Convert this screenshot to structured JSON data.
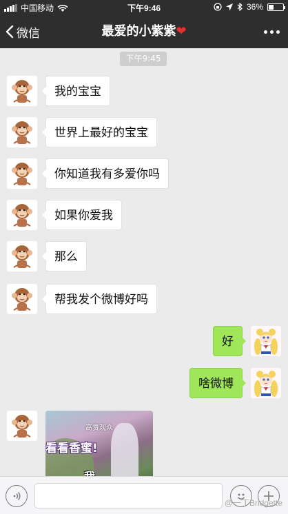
{
  "status_bar": {
    "carrier": "中国移动",
    "time": "下午9:46",
    "battery": "36%",
    "battery_level": 0.36
  },
  "nav": {
    "back_label": "微信",
    "title": "最爱的小紫紫",
    "title_emoji": "❤"
  },
  "chat": {
    "timestamp": "下午9:45",
    "messages": [
      {
        "side": "in",
        "text": "我的宝宝"
      },
      {
        "side": "in",
        "text": "世界上最好的宝宝"
      },
      {
        "side": "in",
        "text": "你知道我有多爱你吗"
      },
      {
        "side": "in",
        "text": "如果你爱我"
      },
      {
        "side": "in",
        "text": "那么"
      },
      {
        "side": "in",
        "text": "帮我发个微博好吗"
      },
      {
        "side": "out",
        "text": "好"
      },
      {
        "side": "out",
        "text": "啥微博"
      }
    ],
    "media_message": {
      "caption_top": "高贵观众",
      "caption_middle": "看看香蜜!",
      "caption_bottom": "我"
    }
  },
  "input_bar": {
    "placeholder": "",
    "voice_icon": "voice-icon",
    "emoji_icon": "emoji-icon",
    "plus_icon": "plus-icon"
  },
  "watermark": "@一丁Bridgette"
}
